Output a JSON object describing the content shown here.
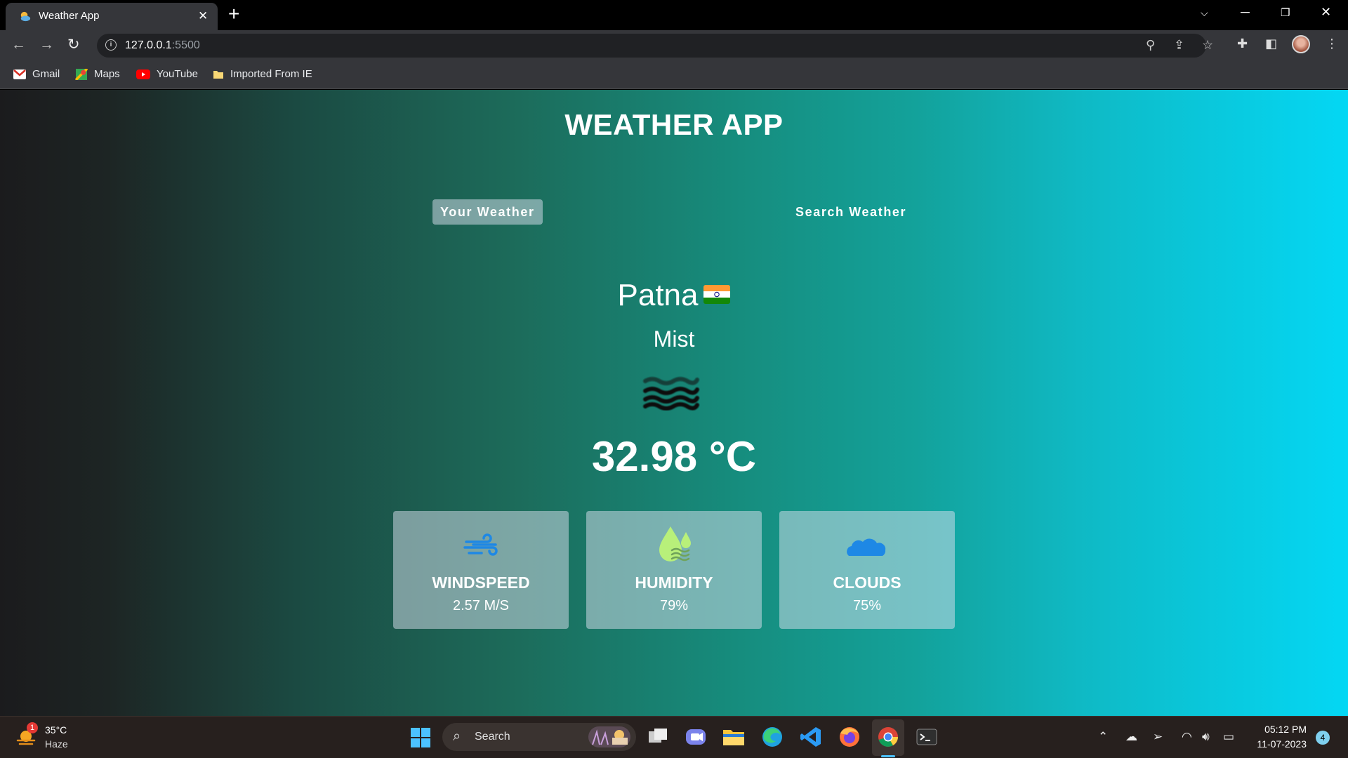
{
  "browser": {
    "tab_title": "Weather App",
    "url_host": "127.0.0.1",
    "url_port": ":5500",
    "bookmarks": [
      "Gmail",
      "Maps",
      "YouTube",
      "Imported From IE"
    ]
  },
  "app": {
    "title": "WEATHER APP",
    "tabs": [
      "Your Weather",
      "Search Weather"
    ],
    "active_tab": "Your Weather",
    "city": "Patna",
    "country_flag": "india-flag",
    "description": "Mist",
    "weather_icon": "mist-icon",
    "temperature": "32.98 °C",
    "cards": [
      {
        "label": "WINDSPEED",
        "value": "2.57 M/S",
        "icon": "wind-icon",
        "color": "#1e88e5"
      },
      {
        "label": "HUMIDITY",
        "value": "79%",
        "icon": "humidity-icon",
        "color": "#b8f07a"
      },
      {
        "label": "CLOUDS",
        "value": "75%",
        "icon": "cloud-icon",
        "color": "#1e88e5"
      }
    ]
  },
  "taskbar": {
    "weather_temp": "35°C",
    "weather_cond": "Haze",
    "weather_badge": "1",
    "search_label": "Search",
    "time": "05:12 PM",
    "date": "11-07-2023",
    "notification_count": "4"
  }
}
